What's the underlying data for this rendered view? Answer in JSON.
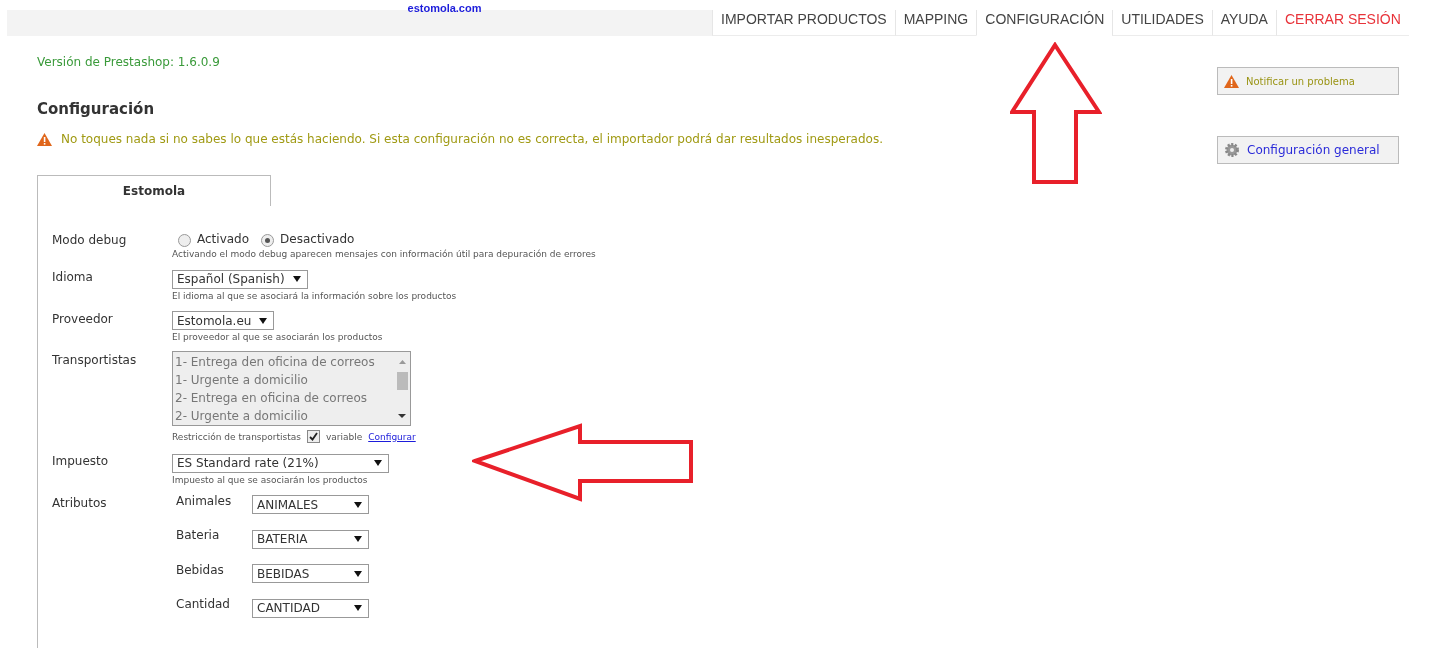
{
  "header": {
    "logo": "estomola.com",
    "nav": [
      {
        "label": "IMPORTAR PRODUCTOS",
        "selected": false,
        "kind": "normal"
      },
      {
        "label": "MAPPING",
        "selected": false,
        "kind": "normal"
      },
      {
        "label": "CONFIGURACIÓN",
        "selected": true,
        "kind": "normal"
      },
      {
        "label": "UTILIDADES",
        "selected": false,
        "kind": "normal"
      },
      {
        "label": "AYUDA",
        "selected": false,
        "kind": "normal"
      },
      {
        "label": "CERRAR SESIÓN",
        "selected": false,
        "kind": "logout"
      }
    ]
  },
  "version": "Versión de Prestashop: 1.6.0.9",
  "title": "Configuración",
  "warning": "No toques nada si no sabes lo que estás haciendo. Si esta configuración no es correcta, el importador podrá dar resultados inesperados.",
  "side_buttons": [
    {
      "label": "Notificar un problema",
      "kind": "warning"
    },
    {
      "label": "Configuración general",
      "kind": "gear"
    }
  ],
  "tab": {
    "label": "Estomola"
  },
  "form": {
    "debug": {
      "label": "Modo debug",
      "options": [
        {
          "label": "Activado",
          "selected": false
        },
        {
          "label": "Desactivado",
          "selected": true
        }
      ],
      "help": "Activando el modo debug aparecen mensajes con información útil para depuración de errores"
    },
    "language": {
      "label": "Idioma",
      "value": "Español (Spanish)",
      "help": "El idioma al que se asociará la información sobre los productos"
    },
    "supplier": {
      "label": "Proveedor",
      "value": "Estomola.eu",
      "help": "El proveedor al que se asociarán los productos"
    },
    "carriers": {
      "label": "Transportistas",
      "options": [
        "1- Entrega den oficina de correos",
        "1- Urgente a domicilio",
        "2- Entrega en oficina de correos",
        "2- Urgente a domicilio"
      ],
      "restriction_label": "Restricción de transportistas",
      "restriction_checked": true,
      "variable_label": "variable",
      "link": "Configurar"
    },
    "tax": {
      "label": "Impuesto",
      "value": "ES Standard rate (21%)",
      "help": "Impuesto al que se asociarán los productos"
    },
    "attributes": {
      "label": "Atributos",
      "rows": [
        {
          "name": "Animales",
          "value": "ANIMALES"
        },
        {
          "name": "Bateria",
          "value": "BATERIA"
        },
        {
          "name": "Bebidas",
          "value": "BEBIDAS"
        },
        {
          "name": "Cantidad",
          "value": "CANTIDAD"
        }
      ]
    }
  }
}
